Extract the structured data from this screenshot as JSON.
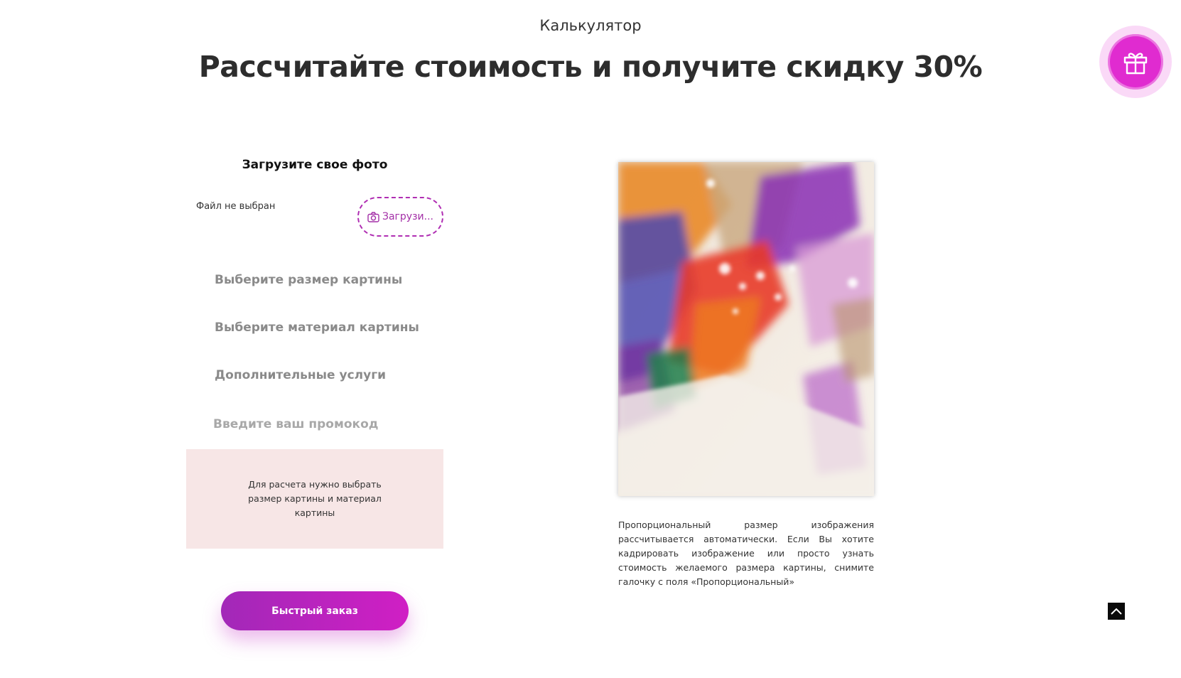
{
  "header": {
    "section_label": "Калькулятор",
    "title": "Рассчитайте стоимость и получите скидку 30%"
  },
  "gift_button": {
    "icon": "gift-icon",
    "color": "#e02bd0"
  },
  "upload": {
    "title": "Загрузите свое фото",
    "file_status": "Файл не выбран",
    "button_label": "Загрузи...",
    "button_icon": "camera-icon"
  },
  "options": {
    "size_label": "Выберите размер картины",
    "material_label": "Выберите материал картины",
    "extra_label": "Дополнительные услуги",
    "promo_placeholder": "Введите ваш промокод"
  },
  "note": {
    "text": "Для расчета нужно выбрать размер картины и материал картины"
  },
  "quick_order": {
    "label": "Быстрый заказ"
  },
  "preview": {
    "caption": "Пропорциональный размер изображения рассчитывается автоматически. Если Вы хотите кадрировать изображение или просто узнать стоимость желаемого размера картины, снимите галочку с поля «Пропорциональный»"
  },
  "scroll_top": {
    "icon": "chevron-up-icon"
  },
  "colors": {
    "accent": "#d01fc4",
    "accent_dark": "#a228b8",
    "note_bg": "#f7e6e6"
  }
}
